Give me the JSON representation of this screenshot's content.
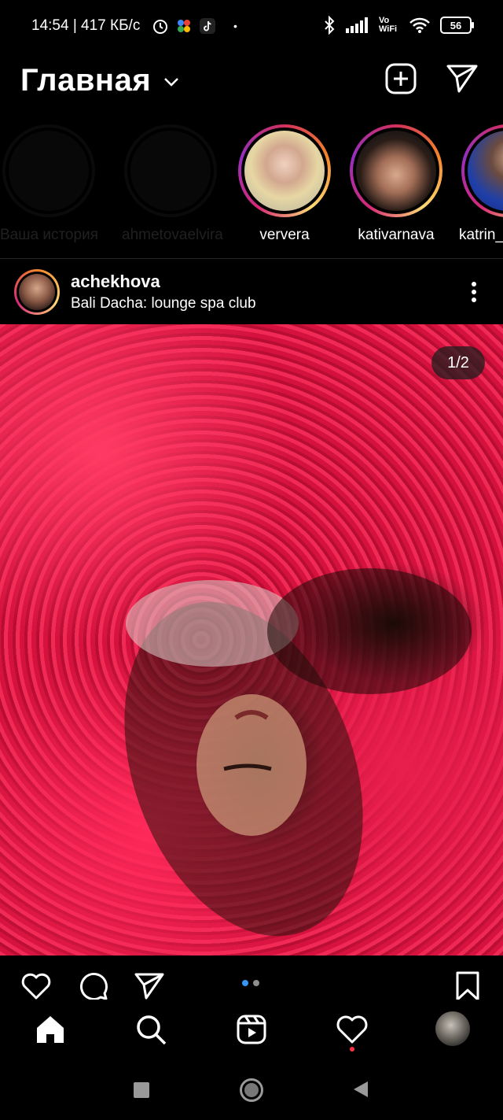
{
  "status_bar": {
    "time": "14:54 | 417 КБ/с",
    "battery": "56",
    "vowifi": "Vo WiFi"
  },
  "header": {
    "title": "Главная"
  },
  "stories": [
    {
      "label": "Ваша история",
      "faded": true
    },
    {
      "label": "ahmetovaelvira",
      "faded": true
    },
    {
      "label": "ververa",
      "faded": false
    },
    {
      "label": "kativarnava",
      "faded": false
    },
    {
      "label": "katrin_",
      "faded": false
    }
  ],
  "post": {
    "username": "achekhova",
    "location": "Bali Dacha: lounge spa club",
    "counter": "1/2"
  },
  "colors": {
    "active_dot": "#3897f0",
    "inactive_dot": "#8e8e8e",
    "notif_dot": "#ff3040"
  }
}
